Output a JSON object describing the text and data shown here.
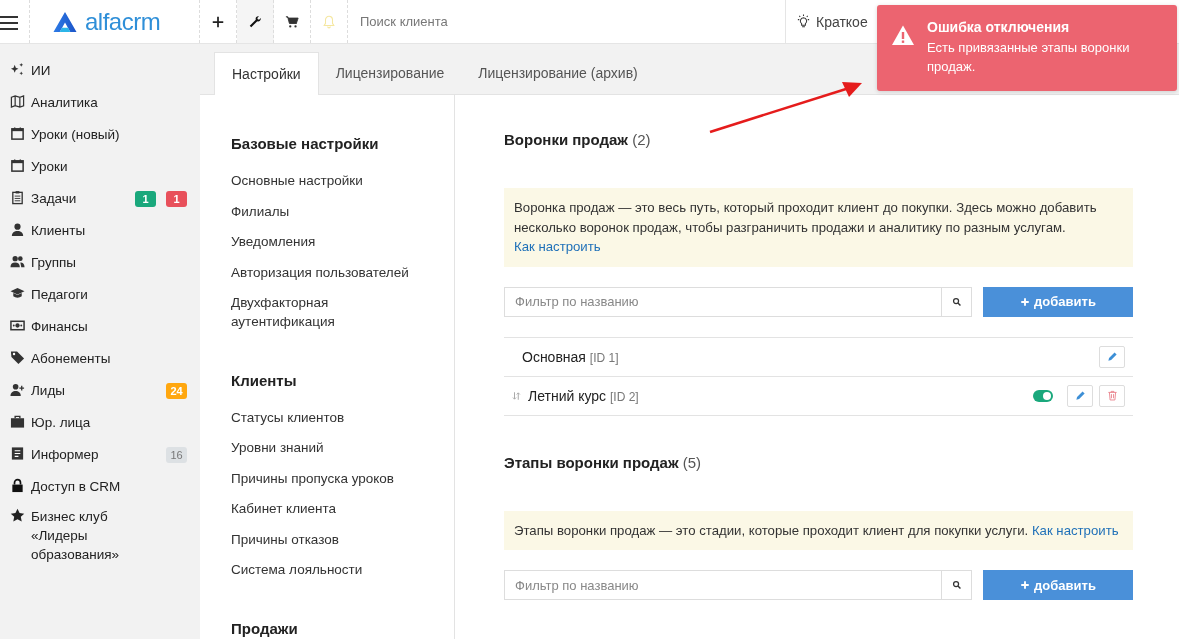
{
  "header": {
    "logo": "alfacrm",
    "search": {
      "placeholder": "Поиск клиента"
    },
    "guide": "Краткое"
  },
  "sidebar": {
    "items": [
      {
        "label": "ИИ"
      },
      {
        "label": "Аналитика"
      },
      {
        "label": "Уроки (новый)"
      },
      {
        "label": "Уроки"
      },
      {
        "label": "Задачи",
        "badges": [
          {
            "text": "1",
            "color": "#1aa87c"
          },
          {
            "text": "1",
            "color": "#e8505b"
          }
        ]
      },
      {
        "label": "Клиенты"
      },
      {
        "label": "Группы"
      },
      {
        "label": "Педагоги"
      },
      {
        "label": "Финансы"
      },
      {
        "label": "Абонементы"
      },
      {
        "label": "Лиды",
        "badges": [
          {
            "text": "24",
            "color": "#ffa70f"
          }
        ]
      },
      {
        "label": "Юр. лица"
      },
      {
        "label": "Информер",
        "badges": [
          {
            "text": "16",
            "color": "#dde1e4"
          }
        ]
      },
      {
        "label": "Доступ в CRM"
      },
      {
        "label": "Бизнес клуб «Лидеры образования»"
      }
    ]
  },
  "tabs": [
    {
      "label": "Настройки",
      "selected": true
    },
    {
      "label": "Лицензирование",
      "selected": false
    },
    {
      "label": "Лицензирование (архив)",
      "selected": false
    }
  ],
  "settings_menu": [
    {
      "title": "Базовые настройки",
      "items": [
        "Основные настройки",
        "Филиалы",
        "Уведомления",
        "Авторизация пользователей",
        "Двухфакторная аутентификация"
      ]
    },
    {
      "title": "Клиенты",
      "items": [
        "Статусы клиентов",
        "Уровни знаний",
        "Причины пропуска уроков",
        "Кабинет клиента",
        "Причины отказов",
        "Система лояльности"
      ]
    },
    {
      "title": "Продажи"
    }
  ],
  "sections": [
    {
      "title": "Воронки продаж",
      "count": "(2)",
      "info": "Воронка продаж — это весь путь, который проходит клиент до покупки. Здесь можно добавить несколько воронок продаж, чтобы разграничить продажи и аналитику по разным услугам.",
      "link": "Как настроить",
      "filter": {
        "placeholder": "Фильтр по названию"
      },
      "add_button": "добавить",
      "rows": [
        {
          "kind": "main",
          "name": "Основная",
          "id": "[ID 1]"
        },
        {
          "kind": "regular",
          "name": "Летний курс",
          "id": "[ID 2]",
          "on": true
        }
      ]
    },
    {
      "title": "Этапы воронки продаж",
      "count": "(5)",
      "info": "Этапы воронки продаж — это стадии, которые проходит клиент для покупки услуги.",
      "link": "Как настроить",
      "filter": {
        "placeholder": "Фильтр по названию"
      },
      "add_button": "добавить"
    }
  ],
  "toast": {
    "title": "Ошибка отключения",
    "message": "Есть привязанные этапы воронки продаж."
  }
}
